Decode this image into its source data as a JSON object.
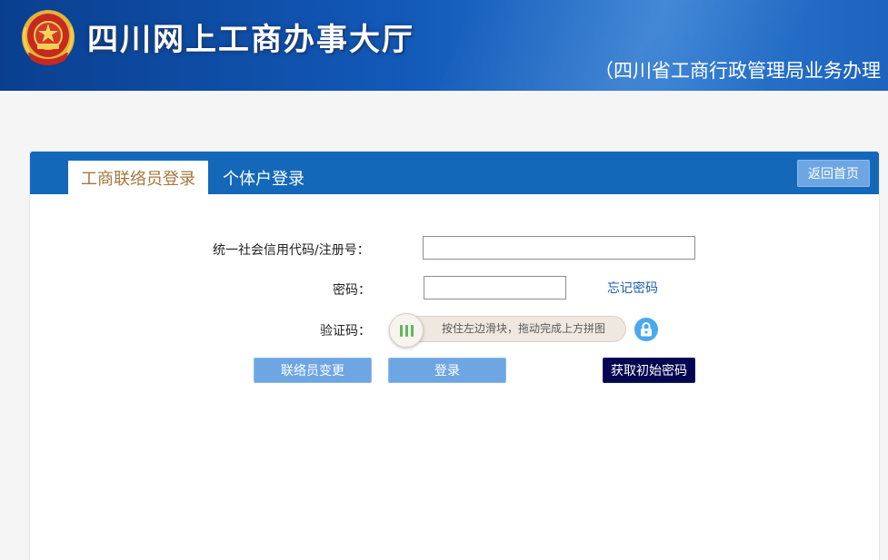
{
  "header": {
    "site_title": "四川网上工商办事大厅",
    "subtitle": "（四川省工商行政管理局业务办理"
  },
  "tabs": {
    "active_label": "工商联络员登录",
    "inactive_label": "个体户登录"
  },
  "nav": {
    "back_home_label": "返回首页"
  },
  "form": {
    "credit_code_label": "统一社会信用代码/注册号：",
    "credit_code_value": "",
    "password_label": "密码：",
    "password_value": "",
    "forgot_password_label": "忘记密码",
    "captcha_label": "验证码：",
    "slider_hint": "按住左边滑块，拖动完成上方拼图"
  },
  "buttons": {
    "change_contact_label": "联络员变更",
    "login_label": "登录",
    "get_initial_password_label": "获取初始密码"
  },
  "colors": {
    "header_blue": "#1259b8",
    "tabbar_blue": "#1468b9",
    "active_tab_text": "#a3783c",
    "light_button": "#6ea6e4",
    "dark_button": "#050550",
    "lock_icon_bg": "#49a9f0",
    "slider_grip": "#5fb85a"
  },
  "icons": {
    "emblem": "national-emblem-icon",
    "slider_grip": "grip-bars-icon",
    "lock": "lock-icon"
  }
}
